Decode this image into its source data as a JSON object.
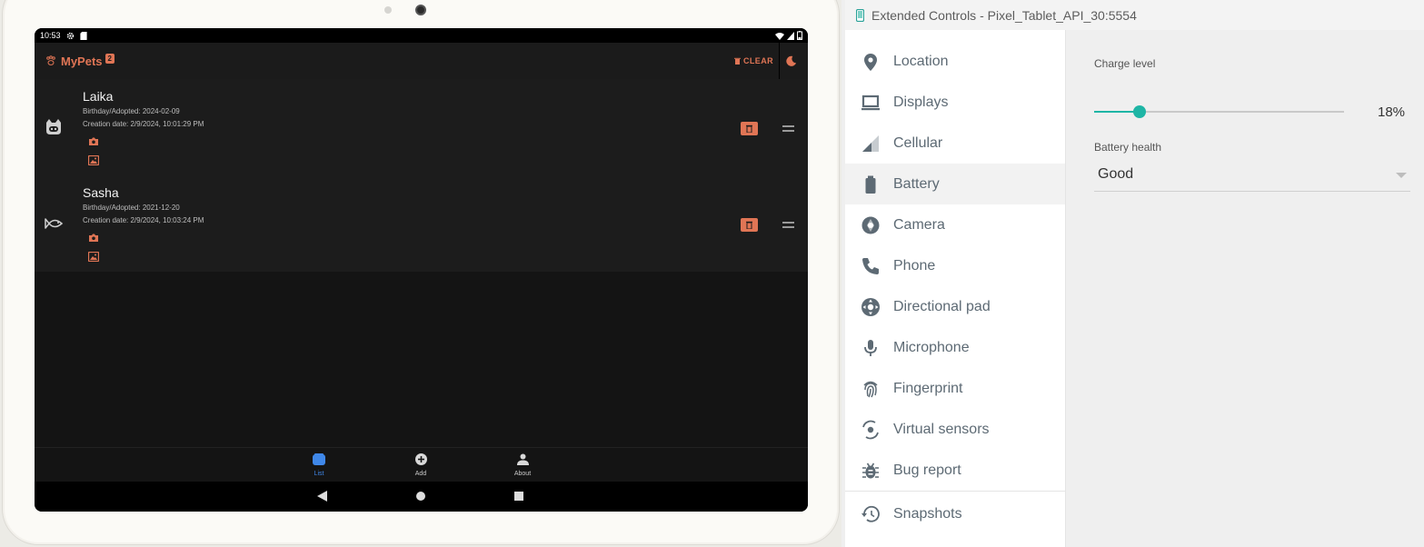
{
  "status_bar": {
    "time": "10:53"
  },
  "app": {
    "title": "MyPets",
    "badge": "2",
    "clear_label": "CLEAR",
    "pets": [
      {
        "name": "Laika",
        "birthday": "Birthday/Adopted: 2024-02-09",
        "created": "Creation date: 2/9/2024, 10:01:29 PM",
        "avatar_icon": "cat-icon"
      },
      {
        "name": "Sasha",
        "birthday": "Birthday/Adopted: 2021-12-20",
        "created": "Creation date: 2/9/2024, 10:03:24 PM",
        "avatar_icon": "fish-icon"
      }
    ],
    "nav": [
      {
        "label": "List",
        "icon": "list-icon",
        "active": true
      },
      {
        "label": "Add",
        "icon": "add-circle-icon",
        "active": false
      },
      {
        "label": "About",
        "icon": "person-icon",
        "active": false
      }
    ],
    "colors": {
      "accent": "#e07555",
      "nav_active": "#3f87e8",
      "background": "#141414"
    }
  },
  "extended_controls": {
    "window_title": "Extended Controls - Pixel_Tablet_API_30:5554",
    "sidebar": [
      {
        "label": "Location",
        "icon": "location-pin-icon"
      },
      {
        "label": "Displays",
        "icon": "display-icon"
      },
      {
        "label": "Cellular",
        "icon": "cellular-signal-icon"
      },
      {
        "label": "Battery",
        "icon": "battery-icon",
        "active": true
      },
      {
        "label": "Camera",
        "icon": "camera-aperture-icon"
      },
      {
        "label": "Phone",
        "icon": "phone-icon"
      },
      {
        "label": "Directional pad",
        "icon": "dpad-icon"
      },
      {
        "label": "Microphone",
        "icon": "microphone-icon"
      },
      {
        "label": "Fingerprint",
        "icon": "fingerprint-icon"
      },
      {
        "label": "Virtual sensors",
        "icon": "rotation-sensor-icon"
      },
      {
        "label": "Bug report",
        "icon": "bug-icon"
      },
      {
        "label": "Snapshots",
        "icon": "history-icon"
      }
    ],
    "battery": {
      "charge_label": "Charge level",
      "charge_percent": 18,
      "charge_value": "18%",
      "health_label": "Battery health",
      "health_value": "Good"
    },
    "colors": {
      "accent": "#1eb5a5",
      "sidebar_text": "#5d6a74"
    }
  }
}
